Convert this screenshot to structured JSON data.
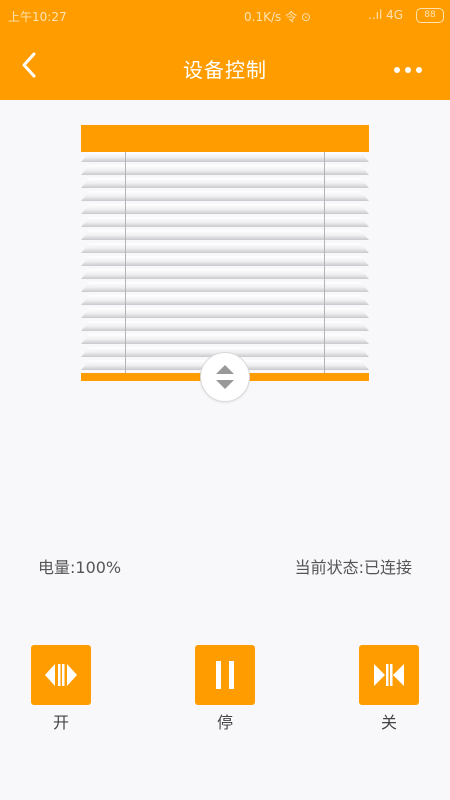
{
  "status_bar": {
    "time": "上午10:27",
    "network_speed": "0.1K/s 令 ⊙",
    "signal": "..ıl 4G",
    "battery": "88"
  },
  "header": {
    "title": "设备控制"
  },
  "status": {
    "battery_text": "电量:100%",
    "connection_text": "当前状态:已连接"
  },
  "controls": [
    {
      "label": "开"
    },
    {
      "label": "停"
    },
    {
      "label": "关"
    }
  ],
  "colors": {
    "accent": "#ff9d00",
    "background": "#f8f8fa"
  }
}
